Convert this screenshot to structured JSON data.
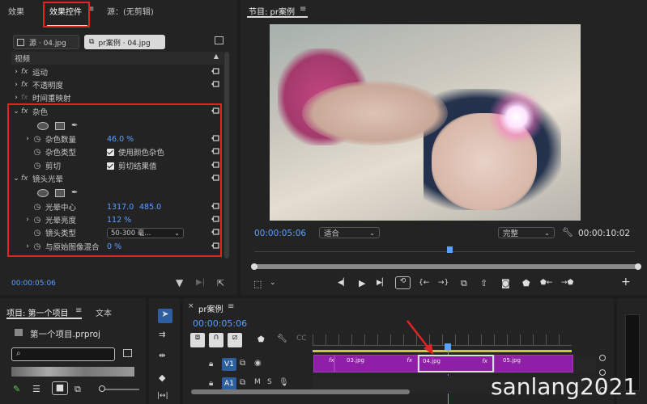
{
  "left_tabs": {
    "effects": "效果",
    "effect_controls": "效果控件",
    "menu_glyph": "≡",
    "source": "源：(无剪辑)"
  },
  "ec_header": {
    "source_clip": "源 · 04.jpg",
    "seq_clip": "pr案例 · 04.jpg"
  },
  "ec_rows": {
    "video": "视频",
    "motion": "运动",
    "opacity": "不透明度",
    "time_remap": "时间重映射",
    "noise": "杂色",
    "noise_amount_label": "杂色数量",
    "noise_amount_value": "46.0 %",
    "noise_type_label": "杂色类型",
    "noise_type_value": "使用颜色杂色",
    "clip_label": "剪切",
    "clip_value": "剪切结果值",
    "lens_flare": "镜头光晕",
    "flare_center_label": "光晕中心",
    "flare_center_x": "1317.0",
    "flare_center_y": "485.0",
    "flare_brightness_label": "光晕亮度",
    "flare_brightness_value": "112 %",
    "lens_type_label": "镜头类型",
    "lens_type_value": "50-300 毫...",
    "blend_label": "与原始图像混合",
    "blend_value": "0 %"
  },
  "ec_footer": {
    "timecode": "00:00:05:06"
  },
  "program": {
    "title": "节目: pr案例",
    "menu_glyph": "≡",
    "timecode": "00:00:05:06",
    "fit": "适合",
    "quality": "完整",
    "duration": "00:00:10:02"
  },
  "project": {
    "title": "项目: 第一个项目",
    "menu_glyph": "≡",
    "text_tab": "文本",
    "file": "第一个项目.prproj",
    "search_placeholder": ""
  },
  "timeline": {
    "title": "pr案例",
    "menu_glyph": "≡",
    "timecode": "00:00:05:06",
    "track_v1": "V1",
    "track_a1": "A1",
    "clips": [
      {
        "name": "03.jpg"
      },
      {
        "name": "04.jpg"
      },
      {
        "name": "05.jpg"
      }
    ]
  },
  "watermark": "sanlang2021",
  "colors": {
    "accent_blue": "#5aa0ff",
    "highlight_red": "#e02424",
    "clip_purple": "#8e1fa6"
  }
}
